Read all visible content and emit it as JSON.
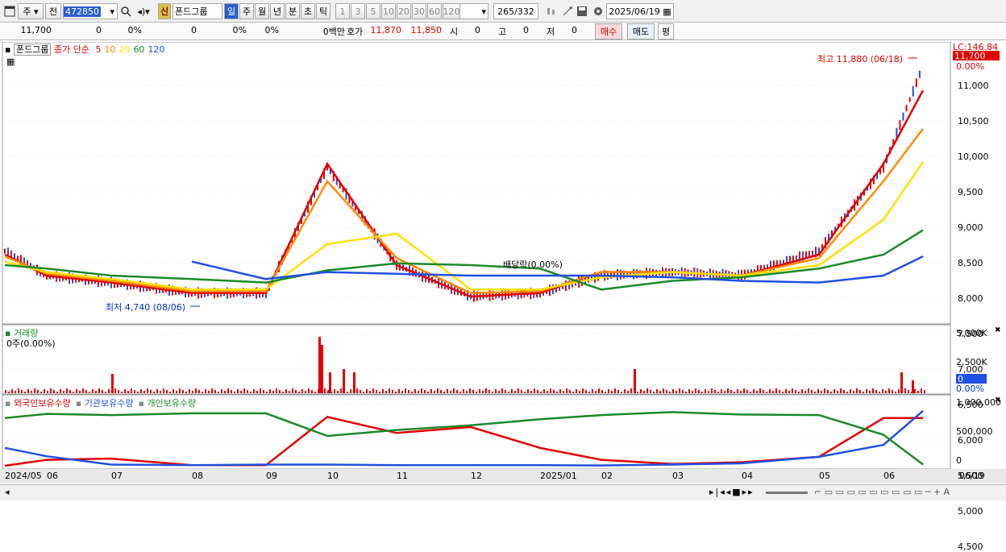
{
  "toolbar": {
    "market": "주",
    "prev": "전",
    "code": "472850",
    "new_badge": "신",
    "stock_name": "폰드그룹",
    "periods": [
      "일",
      "주",
      "월",
      "년",
      "분",
      "초",
      "틱"
    ],
    "active_period": "일",
    "intervals": [
      "1",
      "3",
      "5",
      "10",
      "20",
      "30",
      "60",
      "120"
    ],
    "count": "265",
    "total": "/332",
    "date": "2025/06/19"
  },
  "quote": {
    "price": "11,700",
    "change": "0",
    "change_pct": "0%",
    "vol": "0",
    "vol_pct": "0%",
    "amount_pct": "0%",
    "amount_unit": "0백만",
    "hoga_label": "호가",
    "ask": "11,870",
    "bid": "11,850",
    "open_label": "시",
    "open": "0",
    "high_label": "고",
    "high": "0",
    "low_label": "저",
    "low": "0",
    "buy": "매수",
    "sell": "매도",
    "avg": "평"
  },
  "price_panel": {
    "name": "폰드그룹",
    "ma_label": "종가 단순",
    "ma_periods": [
      "5",
      "10",
      "20",
      "60",
      "120"
    ],
    "ma_colors": [
      "#e00000",
      "#ff8a00",
      "#ffe000",
      "#1a8a2a",
      "#2050e0"
    ],
    "lc": "LC:146.84",
    "current_tag": "11,700",
    "y_ticks": [
      "11,000",
      "10,500",
      "10,000",
      "9,500",
      "9,000",
      "8,500",
      "8,000",
      "7,500",
      "7,000",
      "6,500",
      "6,000",
      "5,500",
      "5,000",
      "4,500"
    ],
    "top_pct": "0.00%",
    "high_note": "최고 11,880 (06/18)",
    "low_note": "최저 4,740 (08/06)",
    "div_note": "배당락(0.00%)"
  },
  "volume_panel": {
    "name": "거래량",
    "value": "0주(0.00%)",
    "y_ticks": [
      "5,000K",
      "2,500K"
    ],
    "tag": "0",
    "pct": "0.00%"
  },
  "holding_panel": {
    "legend": [
      "외국인보유수량",
      "기관보유수량",
      "개인보유수량"
    ],
    "y_ticks": [
      "1,000,000",
      "500,000",
      "0"
    ]
  },
  "x_axis": [
    "2024/05",
    "06",
    "07",
    "08",
    "09",
    "10",
    "11",
    "12",
    "2025/01",
    "02",
    "03",
    "04",
    "05",
    "06",
    "06/19"
  ],
  "chart_data": {
    "type": "line",
    "title": "폰드그룹",
    "x": [
      "2024/05",
      "06",
      "07",
      "08",
      "09",
      "10",
      "11",
      "12",
      "2025/01",
      "02",
      "03",
      "04",
      "05",
      "06",
      "06/19"
    ],
    "series": [
      {
        "name": "종가",
        "values": [
          6400,
          5700,
          5500,
          5200,
          5200,
          8800,
          6000,
          5100,
          5200,
          5700,
          5800,
          5700,
          6400,
          8800,
          11700
        ]
      },
      {
        "name": "5",
        "values": [
          6300,
          5700,
          5500,
          5200,
          5200,
          8900,
          6000,
          5100,
          5200,
          5800,
          5800,
          5700,
          6300,
          8900,
          11000
        ]
      },
      {
        "name": "10",
        "values": [
          6250,
          5750,
          5550,
          5250,
          5250,
          8400,
          6200,
          5200,
          5250,
          5800,
          5800,
          5700,
          6200,
          8400,
          9900
        ]
      },
      {
        "name": "20",
        "values": [
          6100,
          5800,
          5600,
          5300,
          5300,
          6600,
          6900,
          5300,
          5300,
          5650,
          5800,
          5700,
          6000,
          7300,
          8950
        ]
      },
      {
        "name": "60",
        "values": [
          6000,
          5900,
          5700,
          5600,
          5500,
          5850,
          6050,
          6000,
          5900,
          5300,
          5550,
          5650,
          5900,
          6300,
          7000
        ]
      },
      {
        "name": "120",
        "values": [
          null,
          null,
          null,
          6100,
          5600,
          5800,
          5750,
          5700,
          5700,
          5700,
          5650,
          5550,
          5500,
          5700,
          6250
        ]
      },
      {
        "name": "외국인보유수량",
        "values": [
          0,
          100000,
          120000,
          10000,
          10000,
          820000,
          550000,
          650000,
          300000,
          100000,
          30000,
          60000,
          150000,
          800000,
          800000
        ]
      },
      {
        "name": "기관보유수량",
        "values": [
          300000,
          160000,
          20000,
          10000,
          20000,
          20000,
          10000,
          10000,
          10000,
          5000,
          20000,
          40000,
          150000,
          350000,
          920000
        ]
      },
      {
        "name": "개인보유수량",
        "values": [
          800000,
          870000,
          850000,
          880000,
          880000,
          500000,
          600000,
          680000,
          780000,
          850000,
          900000,
          860000,
          850000,
          520000,
          20000
        ]
      }
    ],
    "ylim": [
      4500,
      11880
    ]
  }
}
